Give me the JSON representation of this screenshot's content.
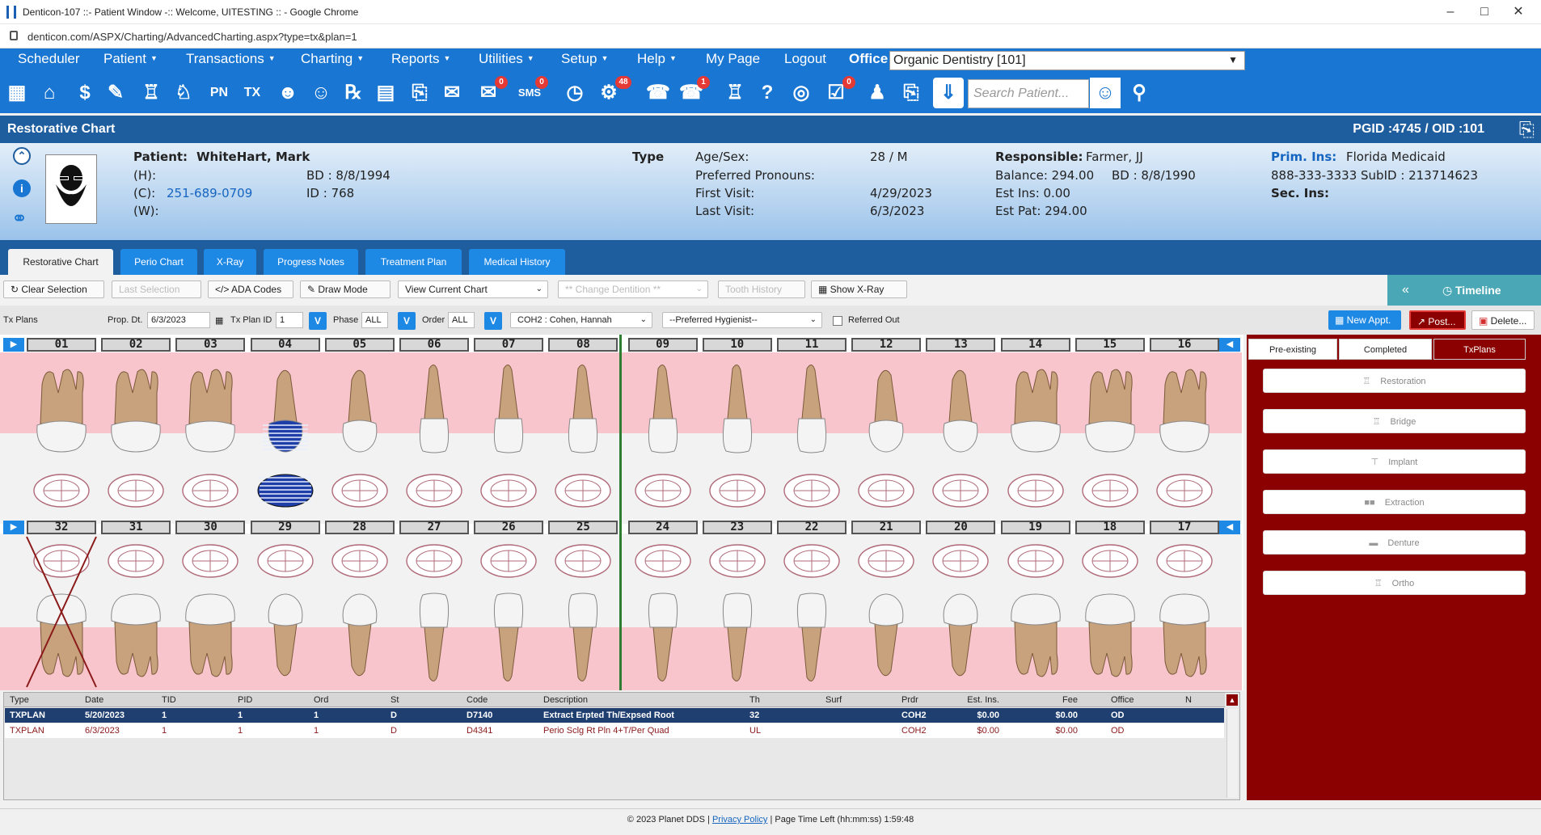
{
  "browser": {
    "title": "Denticon-107 ::- Patient Window -:: Welcome, UITESTING :: - Google Chrome",
    "url": "denticon.com/ASPX/Charting/AdvancedCharting.aspx?type=tx&plan=1"
  },
  "menu": {
    "items": [
      "Scheduler",
      "Patient",
      "Transactions",
      "Charting",
      "Reports",
      "Utilities",
      "Setup",
      "Help",
      "My Page",
      "Logout"
    ],
    "office_label": "Office",
    "office_value": "Organic Dentistry [101]"
  },
  "iconbar": {
    "tx_label": "TX",
    "pn_label": "PN",
    "sms_label": "SMS",
    "badges": [
      "0",
      "0",
      "48",
      "1",
      "0"
    ],
    "search_placeholder": "Search Patient..."
  },
  "header": {
    "title": "Restorative Chart",
    "ids": "PGID :4745  /  OID :101"
  },
  "patient": {
    "name_label": "Patient:",
    "name": "WhiteHart, Mark",
    "home_label": "(H):",
    "cell_label": "(C):",
    "cell": "251-689-0709",
    "work_label": "(W):",
    "bd": "BD : 8/8/1994",
    "id": "ID : 768",
    "type_label": "Type",
    "age_sex_label": "Age/Sex:",
    "age_sex": "28 / M",
    "pronouns_label": "Preferred Pronouns:",
    "first_visit_label": "First Visit:",
    "first_visit": "4/29/2023",
    "last_visit_label": "Last Visit:",
    "last_visit": "6/3/2023",
    "responsible_label": "Responsible:",
    "responsible": "Farmer, JJ",
    "balance": "Balance: 294.00",
    "resp_bd": "BD : 8/8/1990",
    "est_ins": "Est Ins:  0.00",
    "est_pat": "Est Pat: 294.00",
    "prim_ins_label": "Prim. Ins:",
    "prim_ins": "Florida Medicaid",
    "prim_ins_phone": "888-333-3333 SubID : 213714623",
    "sec_ins_label": "Sec. Ins:"
  },
  "tabs": [
    "Restorative Chart",
    "Perio Chart",
    "X-Ray",
    "Progress Notes",
    "Treatment Plan",
    "Medical History"
  ],
  "toolbar": {
    "clear_selection": "Clear Selection",
    "last_selection": "Last Selection",
    "ada_codes": "ADA Codes",
    "draw_mode": "Draw Mode",
    "view_current_chart": "View Current Chart",
    "change_dentition": "** Change Dentition **",
    "tooth_history": "Tooth History",
    "show_xray": "Show X-Ray",
    "timeline": "Timeline"
  },
  "txplans": {
    "label": "Tx Plans",
    "prop_dt_label": "Prop. Dt.",
    "prop_dt": "6/3/2023",
    "tx_plan_id_label": "Tx Plan ID",
    "tx_plan_id": "1",
    "phase_label": "Phase",
    "phase": "ALL",
    "order_label": "Order",
    "order": "ALL",
    "v": "V",
    "provider": "COH2 : Cohen, Hannah",
    "hygienist": "--Preferred Hygienist--",
    "referred_out": "Referred Out",
    "new_appt": "New Appt.",
    "post": "Post...",
    "delete": "Delete..."
  },
  "teeth": {
    "upper": [
      "01",
      "02",
      "03",
      "04",
      "05",
      "06",
      "07",
      "08",
      "09",
      "10",
      "11",
      "12",
      "13",
      "14",
      "15",
      "16"
    ],
    "lower": [
      "32",
      "31",
      "30",
      "29",
      "28",
      "27",
      "26",
      "25",
      "24",
      "23",
      "22",
      "21",
      "20",
      "19",
      "18",
      "17"
    ]
  },
  "right_panel": {
    "tabs": [
      "Pre-existing",
      "Completed",
      "TxPlans"
    ],
    "buttons": [
      "Restoration",
      "Bridge",
      "Implant",
      "Extraction",
      "Denture",
      "Ortho"
    ]
  },
  "grid": {
    "columns": [
      "Type",
      "Date",
      "TID",
      "PID",
      "Ord",
      "St",
      "Code",
      "Description",
      "Th",
      "Surf",
      "Prdr",
      "Est. Ins.",
      "Fee",
      "Office",
      "N"
    ],
    "rows": [
      [
        "TXPLAN",
        "5/20/2023",
        "1",
        "1",
        "1",
        "D",
        "D7140",
        "Extract Erpted Th/Expsed Root",
        "32",
        "",
        "COH2",
        "$0.00",
        "$0.00",
        "OD",
        ""
      ],
      [
        "TXPLAN",
        "6/3/2023",
        "1",
        "1",
        "1",
        "D",
        "D4341",
        "Perio Sclg Rt Pln 4+T/Per Quad",
        "UL",
        "",
        "COH2",
        "$0.00",
        "$0.00",
        "OD",
        ""
      ]
    ]
  },
  "footer": {
    "copyright": "© 2023 Planet DDS |",
    "privacy": "Privacy Policy",
    "time_left": "| Page Time Left (hh:mm:ss) 1:59:48"
  }
}
